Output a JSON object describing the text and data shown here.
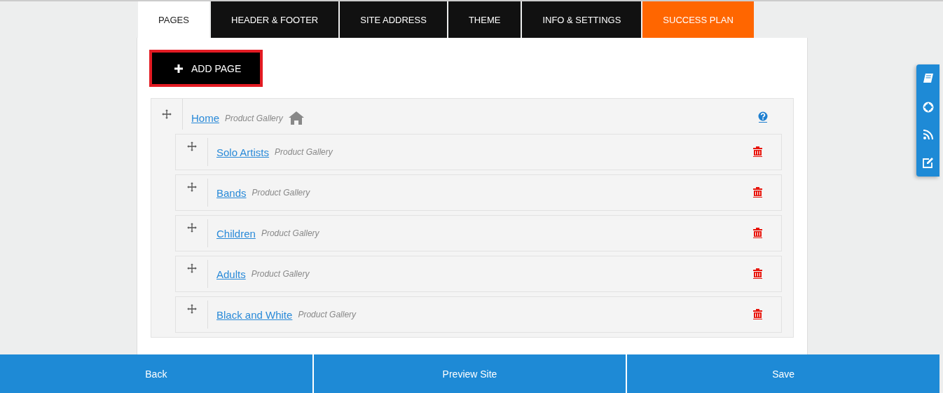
{
  "tabs": [
    {
      "label": "PAGES",
      "selected": true,
      "kind": "plain"
    },
    {
      "label": "HEADER & FOOTER",
      "selected": false,
      "kind": "plain"
    },
    {
      "label": "SITE ADDRESS",
      "selected": false,
      "kind": "plain"
    },
    {
      "label": "THEME",
      "selected": false,
      "kind": "plain"
    },
    {
      "label": "INFO & SETTINGS",
      "selected": false,
      "kind": "plain"
    },
    {
      "label": "SUCCESS PLAN",
      "selected": false,
      "kind": "highlight"
    }
  ],
  "add_button": {
    "label": "ADD PAGE"
  },
  "tree": {
    "name": "Home",
    "type": "Product Gallery",
    "children": [
      {
        "name": "Solo Artists",
        "type": "Product Gallery"
      },
      {
        "name": "Bands",
        "type": "Product Gallery"
      },
      {
        "name": "Children",
        "type": "Product Gallery"
      },
      {
        "name": "Adults",
        "type": "Product Gallery"
      },
      {
        "name": "Black and White",
        "type": "Product Gallery"
      }
    ]
  },
  "footer": [
    "Back",
    "Preview Site",
    "Save"
  ]
}
